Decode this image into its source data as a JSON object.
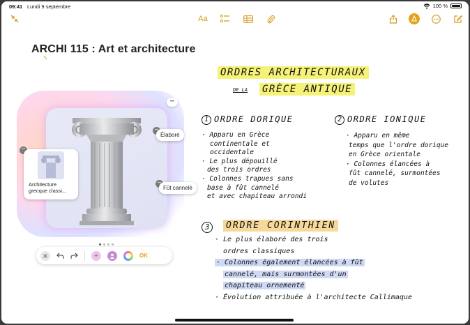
{
  "status": {
    "time": "09:41",
    "date": "Lundi 9 septembre",
    "battery": "100 %"
  },
  "toolbar": {
    "font_label": "Aa",
    "accent": "#d39b1b"
  },
  "note": {
    "title": "ARCHI 115 : Art et architecture"
  },
  "canvas": {
    "chip_elabore": "Élaboré",
    "chip_fut": "Fût cannelé",
    "chip_image_title_1": "Architecture",
    "chip_image_title_2": "grecque classi...",
    "ok_label": "OK",
    "more_label": "•••"
  },
  "handwriting": {
    "heading1": "ORDRES ARCHITECTURAUX",
    "heading_de_la": "DE LA",
    "heading2": "GRÈCE ANTIQUE",
    "dorique_num": "1",
    "dorique_title": "ORDRE DORIQUE",
    "dorique_lines": [
      "· Apparu en Grèce",
      "continentale et",
      "occidentale",
      "· Le plus dépouillé",
      "des trois ordres",
      "· Colonnes trapues sans",
      "base à fût cannelé",
      "et avec chapiteau arrondi"
    ],
    "ionique_num": "2",
    "ionique_title": "ORDRE IONIQUE",
    "ionique_lines": [
      "· Apparu en même",
      "temps que l'ordre dorique",
      "en Grèce orientale",
      "· Colonnes élancées à",
      "fût cannelé, surmontées",
      "de volutes"
    ],
    "corinthien_num": "3",
    "corinthien_title": "ORDRE CORINTHIEN",
    "corinthien_lines": [
      "· Le plus élaboré des trois",
      "ordres classiques",
      "· Colonnes également élancées à fût",
      "cannelé, mais surmontées d'un",
      "chapiteau ornementé",
      "· Évolution attribuée à l'architecte Callimaque"
    ]
  }
}
